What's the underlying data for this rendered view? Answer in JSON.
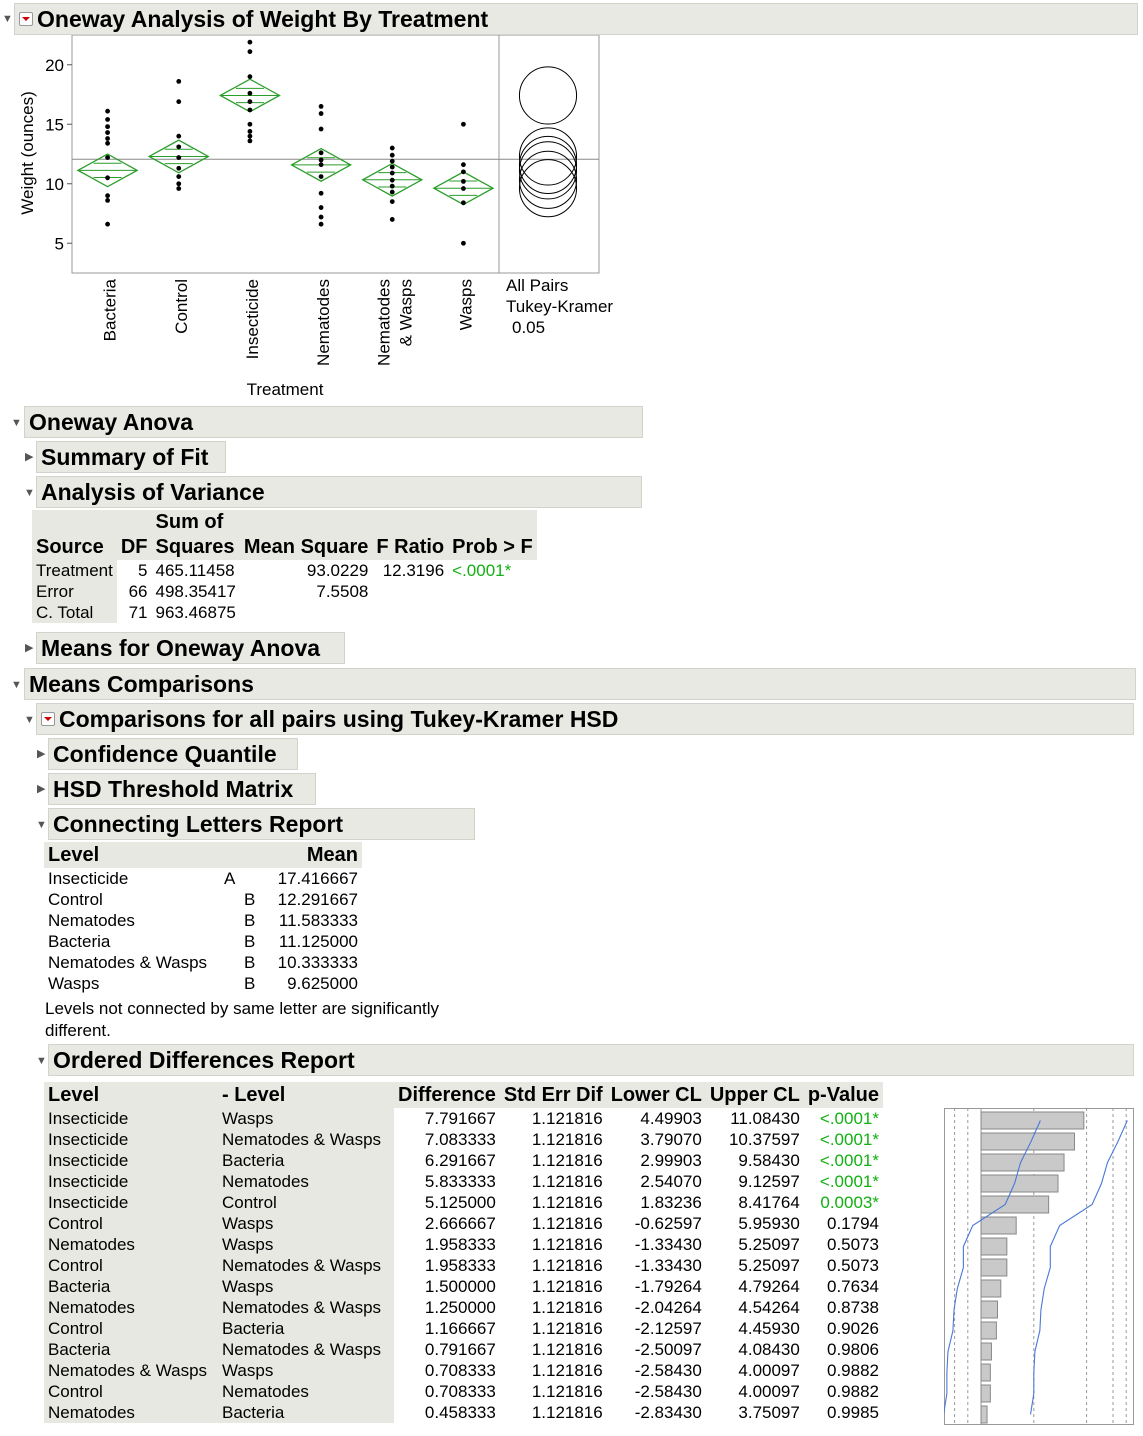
{
  "title": "Oneway Analysis of Weight By Treatment",
  "chart_data": {
    "type": "scatter",
    "ylabel": "Weight (ounces)",
    "xlabel": "Treatment",
    "yticks": [
      "20",
      "15",
      "10",
      "5"
    ],
    "ylim": [
      2.5,
      22.5
    ],
    "grand_mean": 12.06,
    "categories": [
      "Bacteria",
      "Control",
      "Insecticide",
      "Nematodes",
      "Nematodes & Wasps",
      "Wasps"
    ],
    "category_labels": [
      [
        "Bacteria"
      ],
      [
        "Control"
      ],
      [
        "Insecticide"
      ],
      [
        "Nematodes"
      ],
      [
        "Nematodes",
        "& Wasps"
      ],
      [
        "Wasps"
      ]
    ],
    "means": [
      11.125,
      12.291667,
      17.416667,
      11.583333,
      10.333333,
      9.625
    ],
    "ci_halfwidth": 1.37,
    "points": [
      [
        16.1,
        15.4,
        14.8,
        14.3,
        13.8,
        13.4,
        12.2,
        10.5,
        9.0,
        8.6,
        6.6
      ],
      [
        18.6,
        16.9,
        14.0,
        13.1,
        12.2,
        11.3,
        10.6,
        10.0,
        9.6
      ],
      [
        21.9,
        21.1,
        19.0,
        17.6,
        16.9,
        16.2,
        15.0,
        14.4,
        14.0,
        13.6
      ],
      [
        16.5,
        15.9,
        14.6,
        12.6,
        12.0,
        11.6,
        10.6,
        9.2,
        8.0,
        7.2,
        6.6
      ],
      [
        13.0,
        12.4,
        11.9,
        11.4,
        10.9,
        10.3,
        9.8,
        9.3,
        8.5,
        7.0
      ],
      [
        15.0,
        11.6,
        11.0,
        10.2,
        9.6,
        8.4,
        5.0
      ]
    ],
    "comparison_circles_label": [
      "All Pairs",
      "Tukey-Kramer",
      "0.05"
    ]
  },
  "sections": {
    "oneway_anova": "Oneway Anova",
    "summary_of_fit": "Summary of Fit",
    "analysis_of_variance": "Analysis of Variance",
    "means_oneway": "Means for Oneway Anova",
    "means_comparisons": "Means Comparisons",
    "tukey": "Comparisons for all pairs using Tukey-Kramer HSD",
    "confidence_quantile": "Confidence Quantile",
    "hsd_matrix": "HSD Threshold Matrix",
    "connecting_letters": "Connecting Letters Report",
    "ordered_differences": "Ordered Differences Report"
  },
  "anova": {
    "headers": {
      "source": "Source",
      "df": "DF",
      "ss_top": "Sum of",
      "ss_bottom": "Squares",
      "ms": "Mean Square",
      "f": "F Ratio",
      "p": "Prob > F"
    },
    "rows": [
      {
        "source": "Treatment",
        "df": "5",
        "ss": "465.11458",
        "ms": "93.0229",
        "f": "12.3196",
        "p": "<.0001*"
      },
      {
        "source": "Error",
        "df": "66",
        "ss": "498.35417",
        "ms": "7.5508",
        "f": "",
        "p": ""
      },
      {
        "source": "C. Total",
        "df": "71",
        "ss": "963.46875",
        "ms": "",
        "f": "",
        "p": ""
      }
    ]
  },
  "letters": {
    "headers": {
      "level": "Level",
      "mean": "Mean"
    },
    "rows": [
      {
        "level": "Insecticide",
        "a": "A",
        "b": "",
        "mean": "17.416667"
      },
      {
        "level": "Control",
        "a": "",
        "b": "B",
        "mean": "12.291667"
      },
      {
        "level": "Nematodes",
        "a": "",
        "b": "B",
        "mean": "11.583333"
      },
      {
        "level": "Bacteria",
        "a": "",
        "b": "B",
        "mean": "11.125000"
      },
      {
        "level": "Nematodes & Wasps",
        "a": "",
        "b": "B",
        "mean": "10.333333"
      },
      {
        "level": "Wasps",
        "a": "",
        "b": "B",
        "mean": "9.625000"
      }
    ],
    "note": "Levels not connected by same letter are significantly different."
  },
  "ordered": {
    "headers": {
      "level": "Level",
      "minus_level": "- Level",
      "diff": "Difference",
      "se": "Std Err Dif",
      "lower": "Lower CL",
      "upper": "Upper CL",
      "p": "p-Value"
    },
    "rows": [
      {
        "level": "Insecticide",
        "minus": "Wasps",
        "diff": "7.791667",
        "se": "1.121816",
        "lower": "4.49903",
        "upper": "11.08430",
        "p": "<.0001*",
        "sig": true
      },
      {
        "level": "Insecticide",
        "minus": "Nematodes & Wasps",
        "diff": "7.083333",
        "se": "1.121816",
        "lower": "3.79070",
        "upper": "10.37597",
        "p": "<.0001*",
        "sig": true
      },
      {
        "level": "Insecticide",
        "minus": "Bacteria",
        "diff": "6.291667",
        "se": "1.121816",
        "lower": "2.99903",
        "upper": "9.58430",
        "p": "<.0001*",
        "sig": true
      },
      {
        "level": "Insecticide",
        "minus": "Nematodes",
        "diff": "5.833333",
        "se": "1.121816",
        "lower": "2.54070",
        "upper": "9.12597",
        "p": "<.0001*",
        "sig": true
      },
      {
        "level": "Insecticide",
        "minus": "Control",
        "diff": "5.125000",
        "se": "1.121816",
        "lower": "1.83236",
        "upper": "8.41764",
        "p": "0.0003*",
        "sig": true
      },
      {
        "level": "Control",
        "minus": "Wasps",
        "diff": "2.666667",
        "se": "1.121816",
        "lower": "-0.62597",
        "upper": "5.95930",
        "p": "0.1794",
        "sig": false
      },
      {
        "level": "Nematodes",
        "minus": "Wasps",
        "diff": "1.958333",
        "se": "1.121816",
        "lower": "-1.33430",
        "upper": "5.25097",
        "p": "0.5073",
        "sig": false
      },
      {
        "level": "Control",
        "minus": "Nematodes & Wasps",
        "diff": "1.958333",
        "se": "1.121816",
        "lower": "-1.33430",
        "upper": "5.25097",
        "p": "0.5073",
        "sig": false
      },
      {
        "level": "Bacteria",
        "minus": "Wasps",
        "diff": "1.500000",
        "se": "1.121816",
        "lower": "-1.79264",
        "upper": "4.79264",
        "p": "0.7634",
        "sig": false
      },
      {
        "level": "Nematodes",
        "minus": "Nematodes & Wasps",
        "diff": "1.250000",
        "se": "1.121816",
        "lower": "-2.04264",
        "upper": "4.54264",
        "p": "0.8738",
        "sig": false
      },
      {
        "level": "Control",
        "minus": "Bacteria",
        "diff": "1.166667",
        "se": "1.121816",
        "lower": "-2.12597",
        "upper": "4.45930",
        "p": "0.9026",
        "sig": false
      },
      {
        "level": "Bacteria",
        "minus": "Nematodes & Wasps",
        "diff": "0.791667",
        "se": "1.121816",
        "lower": "-2.50097",
        "upper": "4.08430",
        "p": "0.9806",
        "sig": false
      },
      {
        "level": "Nematodes & Wasps",
        "minus": "Wasps",
        "diff": "0.708333",
        "se": "1.121816",
        "lower": "-2.58430",
        "upper": "4.00097",
        "p": "0.9882",
        "sig": false
      },
      {
        "level": "Control",
        "minus": "Nematodes",
        "diff": "0.708333",
        "se": "1.121816",
        "lower": "-2.58430",
        "upper": "4.00097",
        "p": "0.9882",
        "sig": false
      },
      {
        "level": "Nematodes",
        "minus": "Bacteria",
        "diff": "0.458333",
        "se": "1.121816",
        "lower": "-2.83430",
        "upper": "3.75097",
        "p": "0.9985",
        "sig": false
      }
    ]
  },
  "colors": {
    "green": "#12b012",
    "diamond": "#2a9d2a",
    "header_bg": "#e9e9e4",
    "cl_line": "#4a78d8"
  }
}
